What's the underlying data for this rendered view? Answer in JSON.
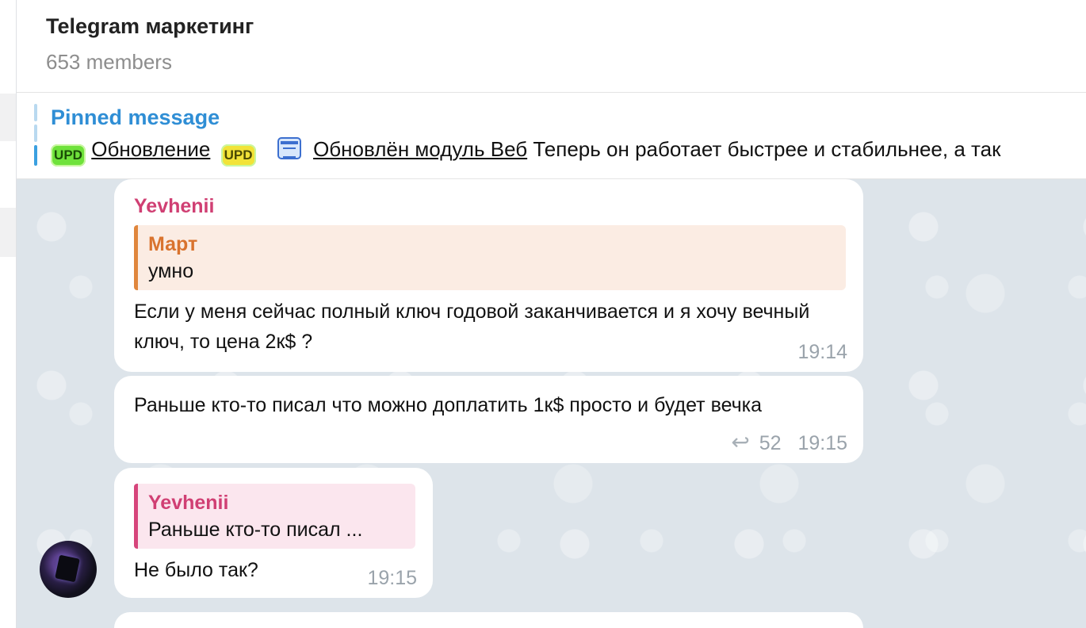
{
  "header": {
    "title": "Telegram маркетинг",
    "subtitle": "653 members"
  },
  "pinned": {
    "label": "Pinned message",
    "badge1": "UPD",
    "text1": "Обновление",
    "badge2": "UPD",
    "text2": "Обновлён модуль Веб",
    "text3": "Теперь он работает быстрее и стабильнее, а так",
    "badge_icon": "upd-badge-icon",
    "doc_icon": "document-icon"
  },
  "messages": [
    {
      "sender": "Yevhenii",
      "reply_to_name": "Март",
      "reply_to_text": "умно",
      "text": "Если у меня сейчас полный ключ годовой заканчивается и я хочу вечный ключ, то цена 2к$ ?",
      "time": "19:14"
    },
    {
      "text": "Раньше кто-то писал что можно доплатить 1к$ просто и будет вечка",
      "replies": "52",
      "reply_icon": "reply-arrow-icon",
      "time": "19:15"
    },
    {
      "reply_to_name": "Yevhenii",
      "reply_to_text": "Раньше кто-то писал ...",
      "text": "Не было так?",
      "time": "19:15"
    }
  ],
  "colors": {
    "accent": "#2f8ed5",
    "sender": "#d03f73",
    "reply_orange": "#e0863c",
    "chat_bg": "#dde4ea"
  }
}
